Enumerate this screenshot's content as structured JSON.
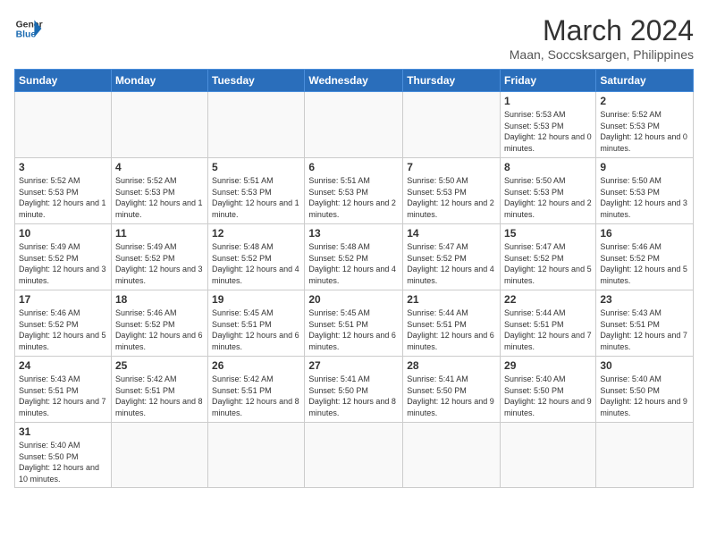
{
  "header": {
    "logo_general": "General",
    "logo_blue": "Blue",
    "month_year": "March 2024",
    "location": "Maan, Soccsksargen, Philippines"
  },
  "weekdays": [
    "Sunday",
    "Monday",
    "Tuesday",
    "Wednesday",
    "Thursday",
    "Friday",
    "Saturday"
  ],
  "weeks": [
    [
      {
        "day": "",
        "info": ""
      },
      {
        "day": "",
        "info": ""
      },
      {
        "day": "",
        "info": ""
      },
      {
        "day": "",
        "info": ""
      },
      {
        "day": "",
        "info": ""
      },
      {
        "day": "1",
        "info": "Sunrise: 5:53 AM\nSunset: 5:53 PM\nDaylight: 12 hours\nand 0 minutes."
      },
      {
        "day": "2",
        "info": "Sunrise: 5:52 AM\nSunset: 5:53 PM\nDaylight: 12 hours\nand 0 minutes."
      }
    ],
    [
      {
        "day": "3",
        "info": "Sunrise: 5:52 AM\nSunset: 5:53 PM\nDaylight: 12 hours\nand 1 minute."
      },
      {
        "day": "4",
        "info": "Sunrise: 5:52 AM\nSunset: 5:53 PM\nDaylight: 12 hours\nand 1 minute."
      },
      {
        "day": "5",
        "info": "Sunrise: 5:51 AM\nSunset: 5:53 PM\nDaylight: 12 hours\nand 1 minute."
      },
      {
        "day": "6",
        "info": "Sunrise: 5:51 AM\nSunset: 5:53 PM\nDaylight: 12 hours\nand 2 minutes."
      },
      {
        "day": "7",
        "info": "Sunrise: 5:50 AM\nSunset: 5:53 PM\nDaylight: 12 hours\nand 2 minutes."
      },
      {
        "day": "8",
        "info": "Sunrise: 5:50 AM\nSunset: 5:53 PM\nDaylight: 12 hours\nand 2 minutes."
      },
      {
        "day": "9",
        "info": "Sunrise: 5:50 AM\nSunset: 5:53 PM\nDaylight: 12 hours\nand 3 minutes."
      }
    ],
    [
      {
        "day": "10",
        "info": "Sunrise: 5:49 AM\nSunset: 5:52 PM\nDaylight: 12 hours\nand 3 minutes."
      },
      {
        "day": "11",
        "info": "Sunrise: 5:49 AM\nSunset: 5:52 PM\nDaylight: 12 hours\nand 3 minutes."
      },
      {
        "day": "12",
        "info": "Sunrise: 5:48 AM\nSunset: 5:52 PM\nDaylight: 12 hours\nand 4 minutes."
      },
      {
        "day": "13",
        "info": "Sunrise: 5:48 AM\nSunset: 5:52 PM\nDaylight: 12 hours\nand 4 minutes."
      },
      {
        "day": "14",
        "info": "Sunrise: 5:47 AM\nSunset: 5:52 PM\nDaylight: 12 hours\nand 4 minutes."
      },
      {
        "day": "15",
        "info": "Sunrise: 5:47 AM\nSunset: 5:52 PM\nDaylight: 12 hours\nand 5 minutes."
      },
      {
        "day": "16",
        "info": "Sunrise: 5:46 AM\nSunset: 5:52 PM\nDaylight: 12 hours\nand 5 minutes."
      }
    ],
    [
      {
        "day": "17",
        "info": "Sunrise: 5:46 AM\nSunset: 5:52 PM\nDaylight: 12 hours\nand 5 minutes."
      },
      {
        "day": "18",
        "info": "Sunrise: 5:46 AM\nSunset: 5:52 PM\nDaylight: 12 hours\nand 6 minutes."
      },
      {
        "day": "19",
        "info": "Sunrise: 5:45 AM\nSunset: 5:51 PM\nDaylight: 12 hours\nand 6 minutes."
      },
      {
        "day": "20",
        "info": "Sunrise: 5:45 AM\nSunset: 5:51 PM\nDaylight: 12 hours\nand 6 minutes."
      },
      {
        "day": "21",
        "info": "Sunrise: 5:44 AM\nSunset: 5:51 PM\nDaylight: 12 hours\nand 6 minutes."
      },
      {
        "day": "22",
        "info": "Sunrise: 5:44 AM\nSunset: 5:51 PM\nDaylight: 12 hours\nand 7 minutes."
      },
      {
        "day": "23",
        "info": "Sunrise: 5:43 AM\nSunset: 5:51 PM\nDaylight: 12 hours\nand 7 minutes."
      }
    ],
    [
      {
        "day": "24",
        "info": "Sunrise: 5:43 AM\nSunset: 5:51 PM\nDaylight: 12 hours\nand 7 minutes."
      },
      {
        "day": "25",
        "info": "Sunrise: 5:42 AM\nSunset: 5:51 PM\nDaylight: 12 hours\nand 8 minutes."
      },
      {
        "day": "26",
        "info": "Sunrise: 5:42 AM\nSunset: 5:51 PM\nDaylight: 12 hours\nand 8 minutes."
      },
      {
        "day": "27",
        "info": "Sunrise: 5:41 AM\nSunset: 5:50 PM\nDaylight: 12 hours\nand 8 minutes."
      },
      {
        "day": "28",
        "info": "Sunrise: 5:41 AM\nSunset: 5:50 PM\nDaylight: 12 hours\nand 9 minutes."
      },
      {
        "day": "29",
        "info": "Sunrise: 5:40 AM\nSunset: 5:50 PM\nDaylight: 12 hours\nand 9 minutes."
      },
      {
        "day": "30",
        "info": "Sunrise: 5:40 AM\nSunset: 5:50 PM\nDaylight: 12 hours\nand 9 minutes."
      }
    ],
    [
      {
        "day": "31",
        "info": "Sunrise: 5:40 AM\nSunset: 5:50 PM\nDaylight: 12 hours\nand 10 minutes."
      },
      {
        "day": "",
        "info": ""
      },
      {
        "day": "",
        "info": ""
      },
      {
        "day": "",
        "info": ""
      },
      {
        "day": "",
        "info": ""
      },
      {
        "day": "",
        "info": ""
      },
      {
        "day": "",
        "info": ""
      }
    ]
  ]
}
